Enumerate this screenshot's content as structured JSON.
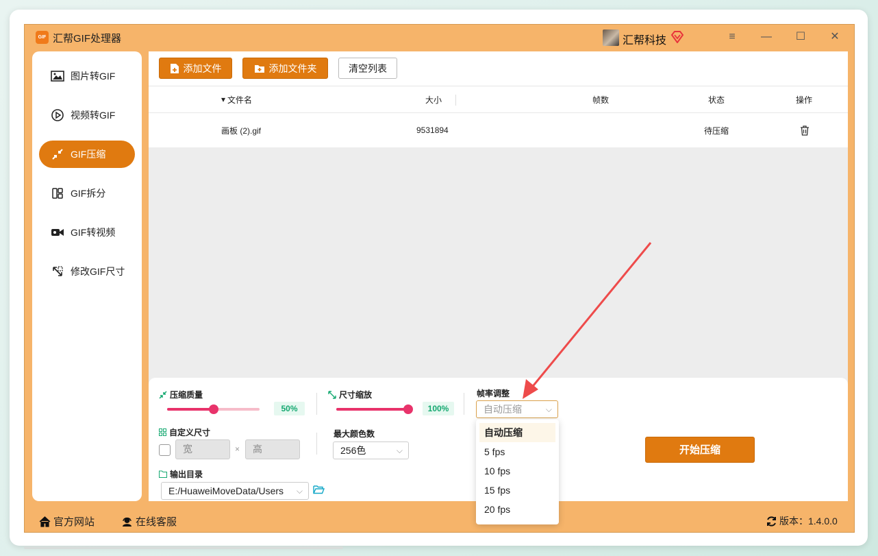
{
  "window": {
    "app_logo_text": "GIF",
    "title": "汇帮GIF处理器",
    "user_name": "汇帮科技",
    "controls": {
      "menu": "≡",
      "minimize": "—",
      "maximize": "☐",
      "close": "✕"
    }
  },
  "sidebar": {
    "items": [
      {
        "label": "图片转GIF",
        "icon": "image-icon"
      },
      {
        "label": "视频转GIF",
        "icon": "play-circle-icon"
      },
      {
        "label": "GIF压缩",
        "icon": "compress-icon",
        "active": true
      },
      {
        "label": "GIF拆分",
        "icon": "split-icon"
      },
      {
        "label": "GIF转视频",
        "icon": "video-camera-icon"
      },
      {
        "label": "修改GIF尺寸",
        "icon": "resize-icon"
      }
    ]
  },
  "toolbar": {
    "add_file": "添加文件",
    "add_folder": "添加文件夹",
    "clear_list": "清空列表"
  },
  "table": {
    "headers": {
      "sort_indicator": "▾",
      "name": "文件名",
      "size": "大小",
      "frames": "帧数",
      "status": "状态",
      "action": "操作"
    },
    "rows": [
      {
        "name": "画板 (2).gif",
        "size": "9531894",
        "frames": "",
        "status": "待压缩"
      }
    ]
  },
  "settings": {
    "quality": {
      "label": "压缩质量",
      "value_text": "50%",
      "fraction": 0.5
    },
    "scale": {
      "label": "尺寸缩放",
      "value_text": "100%",
      "fraction": 1.0
    },
    "framerate": {
      "label": "帧率调整",
      "selected": "自动压缩",
      "options": [
        "自动压缩",
        "5 fps",
        "10 fps",
        "15 fps",
        "20 fps"
      ]
    },
    "custom_size": {
      "label": "自定义尺寸",
      "width_placeholder": "宽",
      "times": "×",
      "height_placeholder": "高"
    },
    "max_colors": {
      "label": "最大颜色数",
      "selected": "256色"
    },
    "output_dir": {
      "label": "输出目录",
      "path": "E:/HuaweiMoveData/Users"
    },
    "start_button": "开始压缩"
  },
  "footer": {
    "website": "官方网站",
    "support": "在线客服",
    "version": "版本：1.4.0.0"
  },
  "colors": {
    "accent": "#e07a10",
    "window_bg": "#f6b46a",
    "slider": "#e8336b",
    "percent_text": "#14a870",
    "annotation_arrow": "#ee4b4b"
  }
}
